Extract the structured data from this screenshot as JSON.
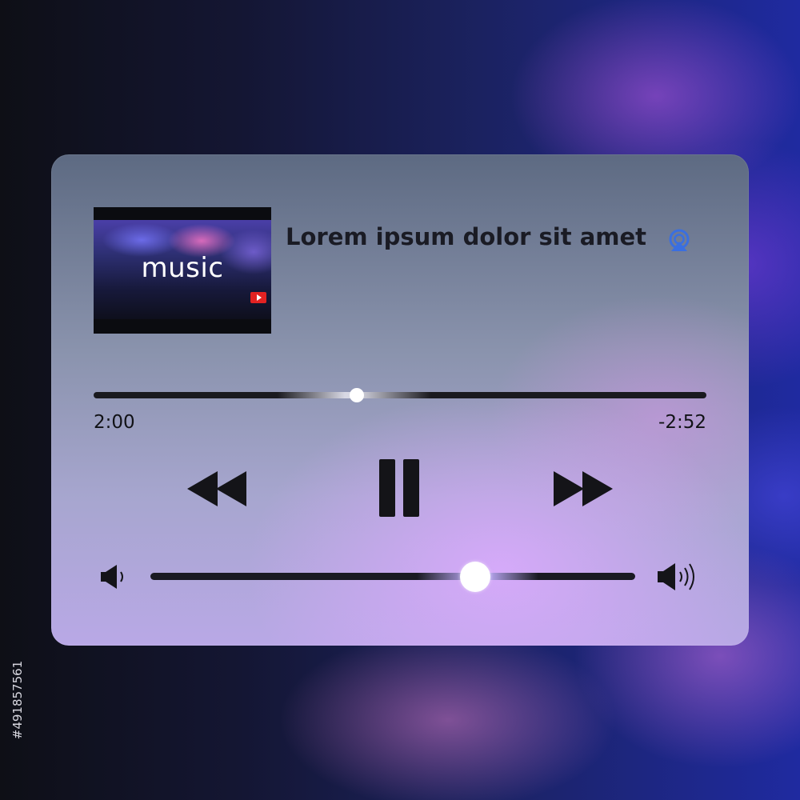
{
  "player": {
    "thumbnail_label": "music",
    "title": "Lorem ipsum dolor sit amet",
    "progress": {
      "elapsed": "2:00",
      "remaining": "-2:52",
      "position_fraction": 0.43
    },
    "volume": {
      "level_fraction": 0.67
    },
    "icons": {
      "airplay": "airplay-icon",
      "thumbnail_badge": "youtube-play-icon",
      "rewind": "rewind-icon",
      "pause": "pause-icon",
      "forward": "fast-forward-icon",
      "volume_low": "volume-low-icon",
      "volume_high": "volume-high-icon"
    },
    "colors": {
      "accent": "#3a6fe0",
      "badge": "#e32222",
      "text": "#1a1b24"
    }
  },
  "watermark": {
    "id": "#491857561"
  }
}
